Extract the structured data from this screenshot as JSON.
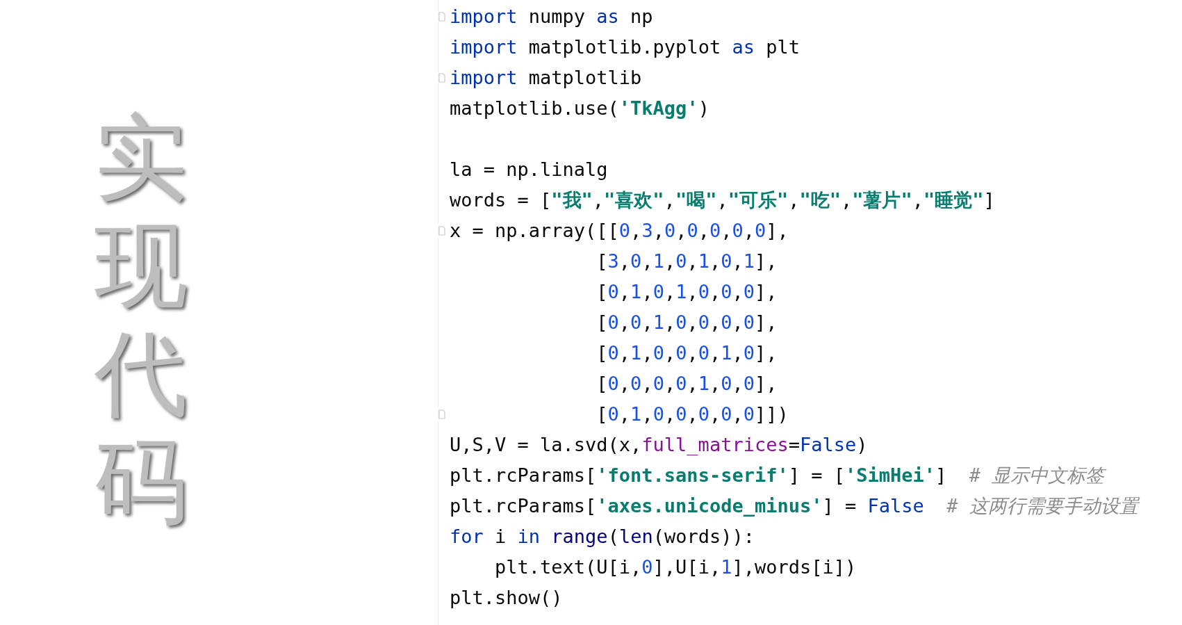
{
  "title": {
    "text": "实现代码"
  },
  "code": {
    "lines": [
      {
        "kind": "code",
        "fold": true,
        "tokens": [
          {
            "kind": "keyword",
            "text": "import"
          },
          {
            "kind": "plain",
            "text": " numpy "
          },
          {
            "kind": "keyword",
            "text": "as"
          },
          {
            "kind": "plain",
            "text": " np"
          }
        ]
      },
      {
        "kind": "code",
        "fold": false,
        "tokens": [
          {
            "kind": "keyword",
            "text": "import"
          },
          {
            "kind": "plain",
            "text": " matplotlib.pyplot "
          },
          {
            "kind": "keyword",
            "text": "as"
          },
          {
            "kind": "plain",
            "text": " plt"
          }
        ]
      },
      {
        "kind": "code",
        "fold": true,
        "tokens": [
          {
            "kind": "keyword",
            "text": "import"
          },
          {
            "kind": "plain",
            "text": " matplotlib"
          }
        ]
      },
      {
        "kind": "code",
        "fold": false,
        "tokens": [
          {
            "kind": "plain",
            "text": "matplotlib.use("
          },
          {
            "kind": "string",
            "text": "'TkAgg'"
          },
          {
            "kind": "plain",
            "text": ")"
          }
        ]
      },
      {
        "kind": "blank"
      },
      {
        "kind": "code",
        "fold": false,
        "tokens": [
          {
            "kind": "plain",
            "text": "la = np.linalg"
          }
        ]
      },
      {
        "kind": "code",
        "fold": false,
        "tokens": [
          {
            "kind": "plain",
            "text": "words = ["
          },
          {
            "kind": "string",
            "text": "\"我\""
          },
          {
            "kind": "plain",
            "text": ","
          },
          {
            "kind": "string",
            "text": "\"喜欢\""
          },
          {
            "kind": "plain",
            "text": ","
          },
          {
            "kind": "string",
            "text": "\"喝\""
          },
          {
            "kind": "plain",
            "text": ","
          },
          {
            "kind": "string",
            "text": "\"可乐\""
          },
          {
            "kind": "plain",
            "text": ","
          },
          {
            "kind": "string",
            "text": "\"吃\""
          },
          {
            "kind": "plain",
            "text": ","
          },
          {
            "kind": "string",
            "text": "\"薯片\""
          },
          {
            "kind": "plain",
            "text": ","
          },
          {
            "kind": "string",
            "text": "\"睡觉\""
          },
          {
            "kind": "plain",
            "text": "]"
          }
        ]
      },
      {
        "kind": "code",
        "fold": true,
        "tokens": [
          {
            "kind": "plain",
            "text": "x = np.array([["
          },
          {
            "kind": "number",
            "text": "0"
          },
          {
            "kind": "plain",
            "text": ","
          },
          {
            "kind": "number",
            "text": "3"
          },
          {
            "kind": "plain",
            "text": ","
          },
          {
            "kind": "number",
            "text": "0"
          },
          {
            "kind": "plain",
            "text": ","
          },
          {
            "kind": "number",
            "text": "0"
          },
          {
            "kind": "plain",
            "text": ","
          },
          {
            "kind": "number",
            "text": "0"
          },
          {
            "kind": "plain",
            "text": ","
          },
          {
            "kind": "number",
            "text": "0"
          },
          {
            "kind": "plain",
            "text": ","
          },
          {
            "kind": "number",
            "text": "0"
          },
          {
            "kind": "plain",
            "text": "],"
          }
        ]
      },
      {
        "kind": "code",
        "fold": false,
        "tokens": [
          {
            "kind": "plain",
            "text": "             ["
          },
          {
            "kind": "number",
            "text": "3"
          },
          {
            "kind": "plain",
            "text": ","
          },
          {
            "kind": "number",
            "text": "0"
          },
          {
            "kind": "plain",
            "text": ","
          },
          {
            "kind": "number",
            "text": "1"
          },
          {
            "kind": "plain",
            "text": ","
          },
          {
            "kind": "number",
            "text": "0"
          },
          {
            "kind": "plain",
            "text": ","
          },
          {
            "kind": "number",
            "text": "1"
          },
          {
            "kind": "plain",
            "text": ","
          },
          {
            "kind": "number",
            "text": "0"
          },
          {
            "kind": "plain",
            "text": ","
          },
          {
            "kind": "number",
            "text": "1"
          },
          {
            "kind": "plain",
            "text": "],"
          }
        ]
      },
      {
        "kind": "code",
        "fold": false,
        "tokens": [
          {
            "kind": "plain",
            "text": "             ["
          },
          {
            "kind": "number",
            "text": "0"
          },
          {
            "kind": "plain",
            "text": ","
          },
          {
            "kind": "number",
            "text": "1"
          },
          {
            "kind": "plain",
            "text": ","
          },
          {
            "kind": "number",
            "text": "0"
          },
          {
            "kind": "plain",
            "text": ","
          },
          {
            "kind": "number",
            "text": "1"
          },
          {
            "kind": "plain",
            "text": ","
          },
          {
            "kind": "number",
            "text": "0"
          },
          {
            "kind": "plain",
            "text": ","
          },
          {
            "kind": "number",
            "text": "0"
          },
          {
            "kind": "plain",
            "text": ","
          },
          {
            "kind": "number",
            "text": "0"
          },
          {
            "kind": "plain",
            "text": "],"
          }
        ]
      },
      {
        "kind": "code",
        "fold": false,
        "tokens": [
          {
            "kind": "plain",
            "text": "             ["
          },
          {
            "kind": "number",
            "text": "0"
          },
          {
            "kind": "plain",
            "text": ","
          },
          {
            "kind": "number",
            "text": "0"
          },
          {
            "kind": "plain",
            "text": ","
          },
          {
            "kind": "number",
            "text": "1"
          },
          {
            "kind": "plain",
            "text": ","
          },
          {
            "kind": "number",
            "text": "0"
          },
          {
            "kind": "plain",
            "text": ","
          },
          {
            "kind": "number",
            "text": "0"
          },
          {
            "kind": "plain",
            "text": ","
          },
          {
            "kind": "number",
            "text": "0"
          },
          {
            "kind": "plain",
            "text": ","
          },
          {
            "kind": "number",
            "text": "0"
          },
          {
            "kind": "plain",
            "text": "],"
          }
        ]
      },
      {
        "kind": "code",
        "fold": false,
        "tokens": [
          {
            "kind": "plain",
            "text": "             ["
          },
          {
            "kind": "number",
            "text": "0"
          },
          {
            "kind": "plain",
            "text": ","
          },
          {
            "kind": "number",
            "text": "1"
          },
          {
            "kind": "plain",
            "text": ","
          },
          {
            "kind": "number",
            "text": "0"
          },
          {
            "kind": "plain",
            "text": ","
          },
          {
            "kind": "number",
            "text": "0"
          },
          {
            "kind": "plain",
            "text": ","
          },
          {
            "kind": "number",
            "text": "0"
          },
          {
            "kind": "plain",
            "text": ","
          },
          {
            "kind": "number",
            "text": "1"
          },
          {
            "kind": "plain",
            "text": ","
          },
          {
            "kind": "number",
            "text": "0"
          },
          {
            "kind": "plain",
            "text": "],"
          }
        ]
      },
      {
        "kind": "code",
        "fold": false,
        "tokens": [
          {
            "kind": "plain",
            "text": "             ["
          },
          {
            "kind": "number",
            "text": "0"
          },
          {
            "kind": "plain",
            "text": ","
          },
          {
            "kind": "number",
            "text": "0"
          },
          {
            "kind": "plain",
            "text": ","
          },
          {
            "kind": "number",
            "text": "0"
          },
          {
            "kind": "plain",
            "text": ","
          },
          {
            "kind": "number",
            "text": "0"
          },
          {
            "kind": "plain",
            "text": ","
          },
          {
            "kind": "number",
            "text": "1"
          },
          {
            "kind": "plain",
            "text": ","
          },
          {
            "kind": "number",
            "text": "0"
          },
          {
            "kind": "plain",
            "text": ","
          },
          {
            "kind": "number",
            "text": "0"
          },
          {
            "kind": "plain",
            "text": "],"
          }
        ]
      },
      {
        "kind": "code",
        "fold": true,
        "tokens": [
          {
            "kind": "plain",
            "text": "             ["
          },
          {
            "kind": "number",
            "text": "0"
          },
          {
            "kind": "plain",
            "text": ","
          },
          {
            "kind": "number",
            "text": "1"
          },
          {
            "kind": "plain",
            "text": ","
          },
          {
            "kind": "number",
            "text": "0"
          },
          {
            "kind": "plain",
            "text": ","
          },
          {
            "kind": "number",
            "text": "0"
          },
          {
            "kind": "plain",
            "text": ","
          },
          {
            "kind": "number",
            "text": "0"
          },
          {
            "kind": "plain",
            "text": ","
          },
          {
            "kind": "number",
            "text": "0"
          },
          {
            "kind": "plain",
            "text": ","
          },
          {
            "kind": "number",
            "text": "0"
          },
          {
            "kind": "plain",
            "text": "]])"
          }
        ]
      },
      {
        "kind": "code",
        "fold": false,
        "tokens": [
          {
            "kind": "plain",
            "text": "U,S,V = la.svd(x,"
          },
          {
            "kind": "param",
            "text": "full_matrices"
          },
          {
            "kind": "plain",
            "text": "="
          },
          {
            "kind": "keyword",
            "text": "False"
          },
          {
            "kind": "plain",
            "text": ")"
          }
        ]
      },
      {
        "kind": "code",
        "fold": false,
        "tokens": [
          {
            "kind": "plain",
            "text": "plt.rcParams["
          },
          {
            "kind": "string",
            "text": "'font.sans-serif'"
          },
          {
            "kind": "plain",
            "text": "] = ["
          },
          {
            "kind": "string",
            "text": "'SimHei'"
          },
          {
            "kind": "plain",
            "text": "]"
          },
          {
            "kind": "comment",
            "text": "  # 显示中文标签"
          }
        ]
      },
      {
        "kind": "code",
        "fold": false,
        "tokens": [
          {
            "kind": "plain",
            "text": "plt.rcParams["
          },
          {
            "kind": "string",
            "text": "'axes.unicode_minus'"
          },
          {
            "kind": "plain",
            "text": "] = "
          },
          {
            "kind": "keyword",
            "text": "False"
          },
          {
            "kind": "comment",
            "text": "  # 这两行需要手动设置"
          }
        ]
      },
      {
        "kind": "code",
        "fold": false,
        "tokens": [
          {
            "kind": "keyword",
            "text": "for"
          },
          {
            "kind": "plain",
            "text": " i "
          },
          {
            "kind": "keyword",
            "text": "in"
          },
          {
            "kind": "builtin",
            "text": " range"
          },
          {
            "kind": "plain",
            "text": "("
          },
          {
            "kind": "builtin",
            "text": "len"
          },
          {
            "kind": "plain",
            "text": "(words)):"
          }
        ]
      },
      {
        "kind": "code",
        "fold": false,
        "tokens": [
          {
            "kind": "plain",
            "text": "    plt.text(U[i,"
          },
          {
            "kind": "number",
            "text": "0"
          },
          {
            "kind": "plain",
            "text": "],U[i,"
          },
          {
            "kind": "number",
            "text": "1"
          },
          {
            "kind": "plain",
            "text": "],words[i])"
          }
        ]
      },
      {
        "kind": "code",
        "fold": false,
        "tokens": [
          {
            "kind": "plain",
            "text": "plt.show()"
          }
        ]
      }
    ]
  }
}
